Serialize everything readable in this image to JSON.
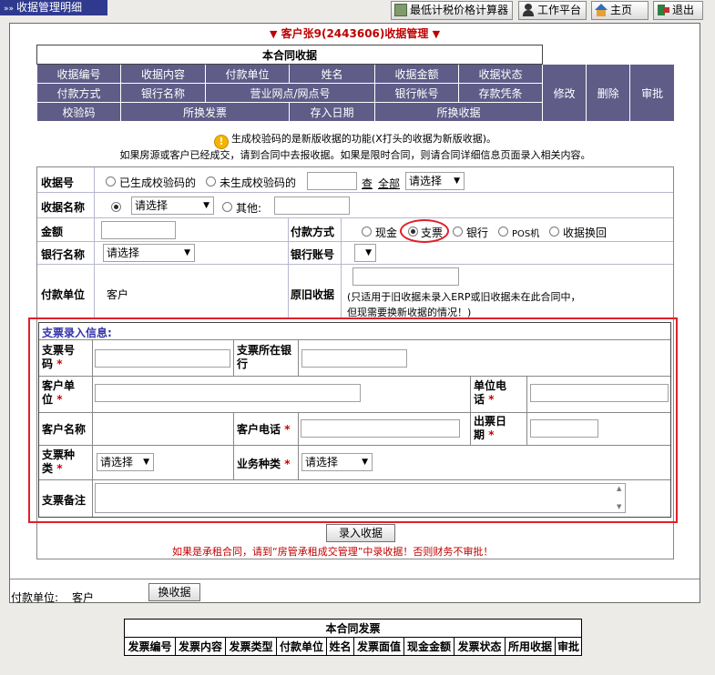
{
  "window_title": "收据管理明细",
  "toolbar": {
    "calc": "最低计税价格计算器",
    "workbench": "工作平台",
    "home": "主页",
    "exit": "退出"
  },
  "customer_title": "客户张9(2443606)收据管理",
  "summary": {
    "caption": "本合同收据",
    "row1": [
      "收据编号",
      "收据内容",
      "付款单位",
      "姓名",
      "收据金额",
      "收据状态"
    ],
    "row2": [
      "付款方式",
      "银行名称",
      "营业网点/网点号",
      "银行帐号",
      "存款凭条"
    ],
    "row3": [
      "校验码",
      "所换发票",
      "存入日期",
      "所换收据"
    ],
    "actions": [
      "修改",
      "删除",
      "审批"
    ]
  },
  "notice": {
    "line1": "生成校验码的是新版收据的功能(X打头的收据为新版收据)。",
    "line2": "如果房源或客户已经成交，请到合同中去报收据。如果是限时合同，则请合同详细信息页面录入相关内容。"
  },
  "form": {
    "receipt_no_label": "收据号",
    "opt_generated": "已生成校验码的",
    "opt_not_generated": "未生成校验码的",
    "search": "查",
    "all": "全部",
    "select_default": "请选择",
    "receipt_name_label": "收据名称",
    "other": "其他:",
    "amount_label": "金额",
    "pay_method_label": "付款方式",
    "pay_methods": [
      "现金",
      "支票",
      "银行",
      "POS机",
      "收据换回"
    ],
    "bank_name_label": "银行名称",
    "bank_account_label": "银行账号",
    "payer_label": "付款单位",
    "payer_value": "客户",
    "old_receipt_label": "原旧收据",
    "old_receipt_hint1": "(只适用于旧收据未录入ERP或旧收据未在此合同中，",
    "old_receipt_hint2": "但现需要换新收据的情况！)"
  },
  "cheque": {
    "title": "支票录入信息:",
    "no_label_1": "支票号",
    "no_label_2": "码",
    "bank_label_1": "支票所在银",
    "bank_label_2": "行",
    "client_unit_1": "客户单",
    "client_unit_2": "位",
    "unit_phone_1": "单位电",
    "unit_phone_2": "话",
    "client_name": "客户名称",
    "client_phone": "客户电话",
    "issue_date_1": "出票日",
    "issue_date_2": "期",
    "type_1": "支票种",
    "type_2": "类",
    "biz_type": "业务种类",
    "note": "支票备注",
    "select_default": "请选择"
  },
  "submit_label": "录入收据",
  "warning_text": "如果是承租合同，请到“房管承租成交管理”中录收据！否则财务不审批！",
  "footer": {
    "payer_label": "付款单位:",
    "payer_value": "客户",
    "exchange_button": "换收据"
  },
  "invoice": {
    "caption": "本合同发票",
    "columns": [
      "发票编号",
      "发票内容",
      "发票类型",
      "付款单位",
      "姓名",
      "发票面值",
      "现金金额",
      "发票状态",
      "所用收据",
      "审批"
    ]
  },
  "colors": {
    "header_bg": "#5f5c88",
    "title_red": "#c00000",
    "highlight_red": "#e0202a",
    "cheque_title_blue": "#3333aa"
  }
}
